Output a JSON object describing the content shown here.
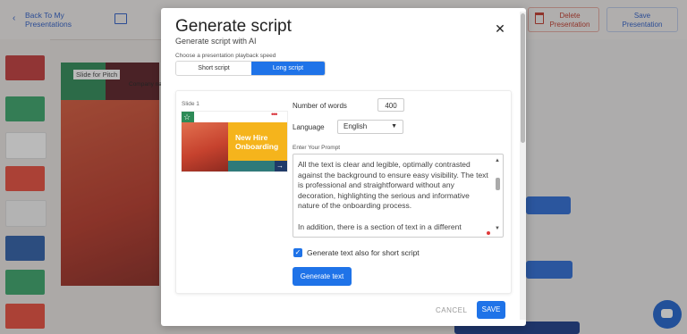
{
  "background": {
    "back_link": "Back To My Presentations",
    "delete_button": "Delete Presentation",
    "save_button": "Save Presentation",
    "canvas_label": "Slide for Pitch",
    "canvas_sublabel": "Company na"
  },
  "modal": {
    "title": "Generate script",
    "subtitle": "Generate script with AI",
    "close_icon": "close-icon",
    "speed_label": "Choose a presentation playback speed",
    "speed_options": [
      "Short script",
      "Long script"
    ],
    "speed_selected": "Long script",
    "slide": {
      "label": "Slide 1",
      "thumb_title": "New Hire Onboarding"
    },
    "words_label": "Number of words",
    "words_value": "400",
    "language_label": "Language",
    "language_value": "English",
    "prompt_label": "Enter Your Prompt",
    "prompt_text": "All the text is clear and legible, optimally contrasted against the background to ensure easy visibility. The text is professional and straightforward without any decoration, highlighting the serious and informative nature of the onboarding process.\n\nIn addition, there is a section of text in a different",
    "checkbox_label": "Generate text also for short script",
    "checkbox_checked": true,
    "generate_button": "Generate text",
    "cancel_button": "CANCEL",
    "save_button": "SAVE"
  },
  "colors": {
    "accent": "#1f73e8",
    "danger": "#c0392b"
  }
}
